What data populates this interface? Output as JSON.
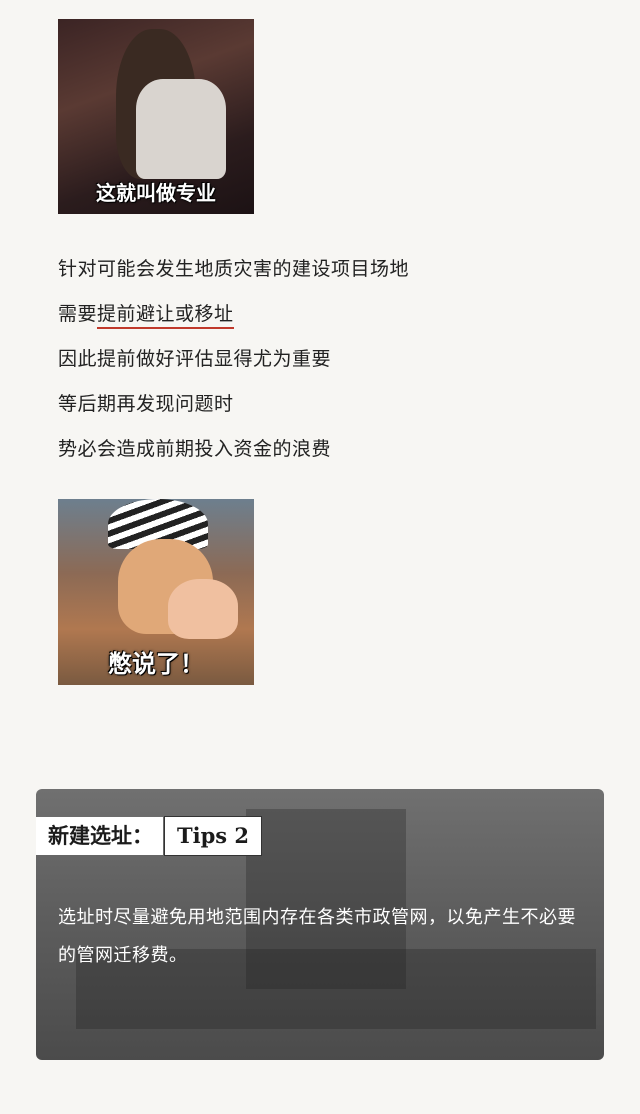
{
  "meme_top": {
    "caption": "这就叫做专业"
  },
  "body_lines": [
    "针对可能会发生地质灾害的建设项目场地",
    "需要",
    "提前避让或移址",
    "因此提前做好评估显得尤为重要",
    "等后期再发现问题时",
    "势必会造成前期投入资金的浪费"
  ],
  "meme_bottom": {
    "caption": "憋说了！"
  },
  "tips": {
    "title": "新建选址：",
    "badge": "Tips 2",
    "text": "选址时尽量避免用地范围内存在各类市政管网，以免产生不必要的管网迁移费。"
  },
  "colors": {
    "underline": "#c0392b",
    "background": "#f7f6f3"
  }
}
